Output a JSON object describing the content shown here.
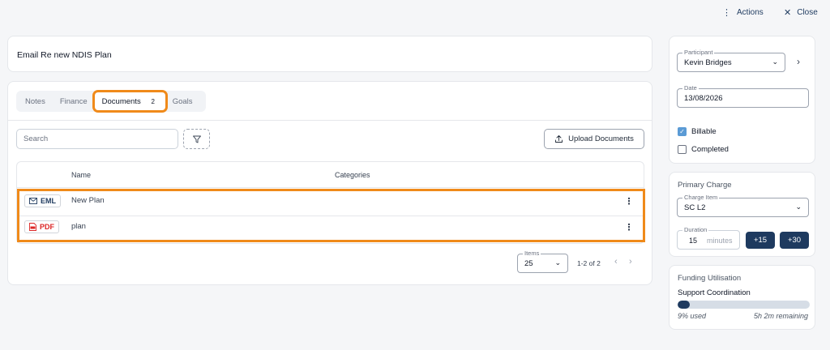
{
  "topbar": {
    "actions_label": "Actions",
    "close_label": "Close"
  },
  "title": "Email Re new NDIS Plan",
  "tabs": [
    {
      "label": "Notes"
    },
    {
      "label": "Finance"
    },
    {
      "label": "Documents",
      "count": "2",
      "active": true
    },
    {
      "label": "Goals"
    }
  ],
  "toolbar": {
    "search_placeholder": "Search",
    "upload_label": "Upload Documents"
  },
  "table": {
    "columns": [
      "Name",
      "Categories"
    ],
    "rows": [
      {
        "type": "EML",
        "name": "New Plan",
        "category": ""
      },
      {
        "type": "PDF",
        "name": "plan",
        "category": ""
      }
    ]
  },
  "pagination": {
    "items_label": "Items",
    "items_value": "25",
    "range": "1-2 of 2"
  },
  "sidebar": {
    "participant": {
      "label": "Participant",
      "value": "Kevin Bridges"
    },
    "date": {
      "label": "Date",
      "value": "13/08/2026"
    },
    "billable": {
      "label": "Billable",
      "checked": true
    },
    "completed": {
      "label": "Completed",
      "checked": false
    },
    "primary_charge": {
      "title": "Primary Charge",
      "charge_item_label": "Charge Item",
      "charge_item_value": "SC L2",
      "duration_label": "Duration",
      "duration_value": "15",
      "duration_unit": "minutes",
      "add15": "+15",
      "add30": "+30"
    },
    "funding": {
      "title": "Funding Utilisation",
      "category": "Support Coordination",
      "used_fraction": 0.09,
      "used_text": "9% used",
      "remaining_text": "5h 2m remaining"
    }
  },
  "colors": {
    "accent": "#1e3a5f",
    "highlight": "#f08a1a",
    "pdf": "#dc2626",
    "checkbox": "#5b9bd5"
  }
}
